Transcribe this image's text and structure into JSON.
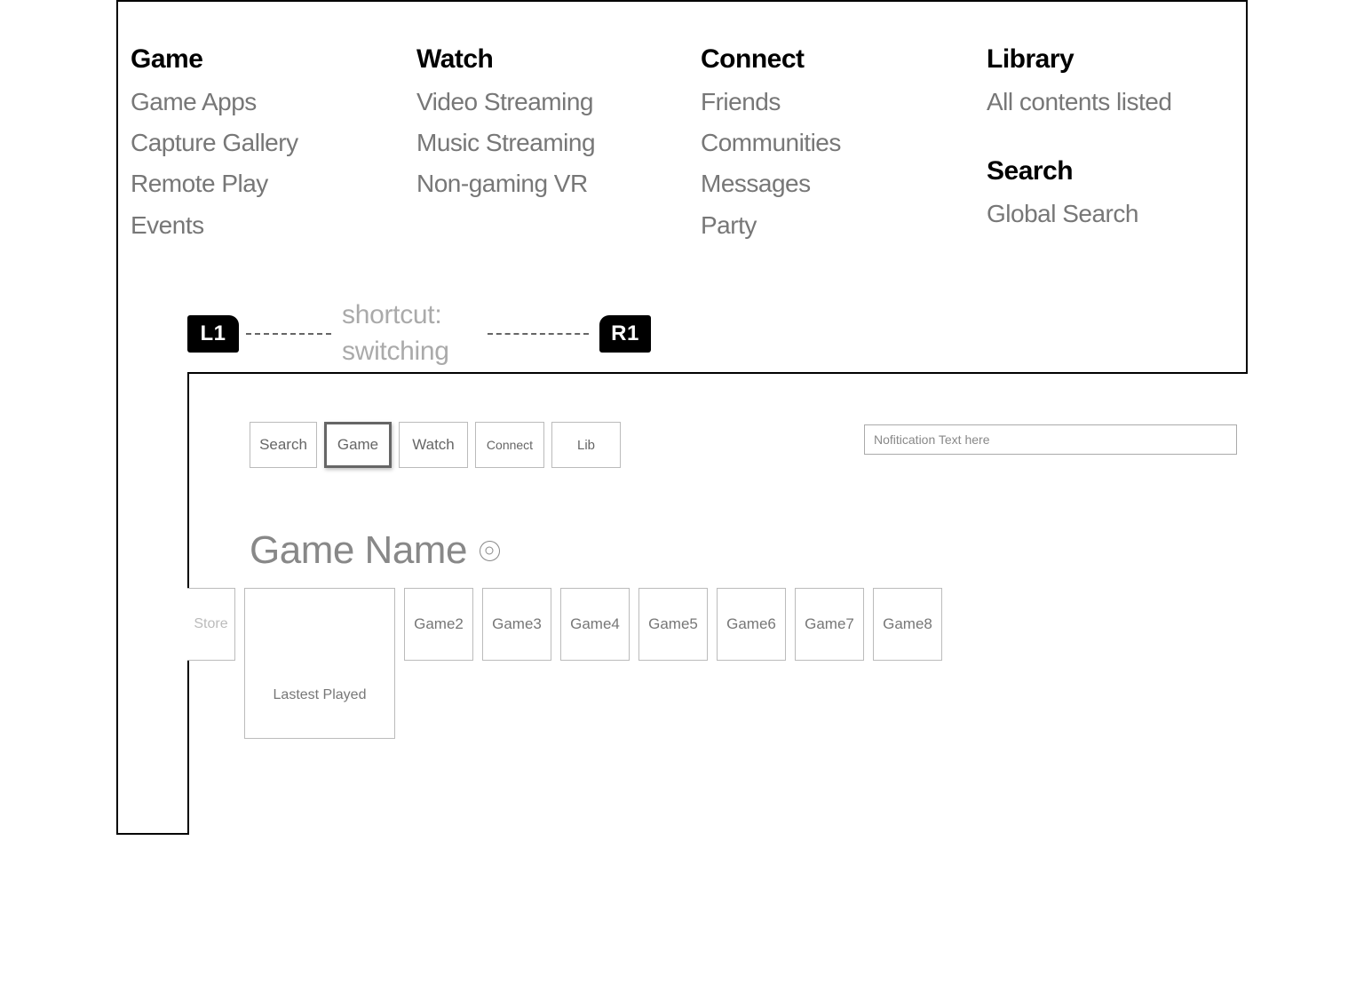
{
  "nav": {
    "col1": {
      "heading": "Game",
      "items": [
        "Game Apps",
        "Capture Gallery",
        "Remote Play",
        "Events"
      ]
    },
    "col2": {
      "heading": "Watch",
      "items": [
        "Video Streaming",
        "Music Streaming",
        "Non-gaming VR"
      ]
    },
    "col3": {
      "heading": "Connect",
      "items": [
        "Friends",
        "Communities",
        "Messages",
        "Party"
      ]
    },
    "col4a": {
      "heading": "Library",
      "items": [
        "All contents listed"
      ]
    },
    "col4b": {
      "heading": "Search",
      "items": [
        "Global Search"
      ]
    }
  },
  "shortcut": {
    "left_btn": "L1",
    "right_btn": "R1",
    "label_line1": "shortcut:",
    "label_line2": "switching"
  },
  "tabs": {
    "search": "Search",
    "game": "Game",
    "watch": "Watch",
    "connect": "Connect",
    "lib": "Lib"
  },
  "notification": "Nofitication Text here",
  "main": {
    "title": "Game Name"
  },
  "tiles": {
    "store": "Store",
    "lastest": "Lastest Played",
    "games": [
      "Game2",
      "Game3",
      "Game4",
      "Game5",
      "Game6",
      "Game7",
      "Game8"
    ]
  }
}
